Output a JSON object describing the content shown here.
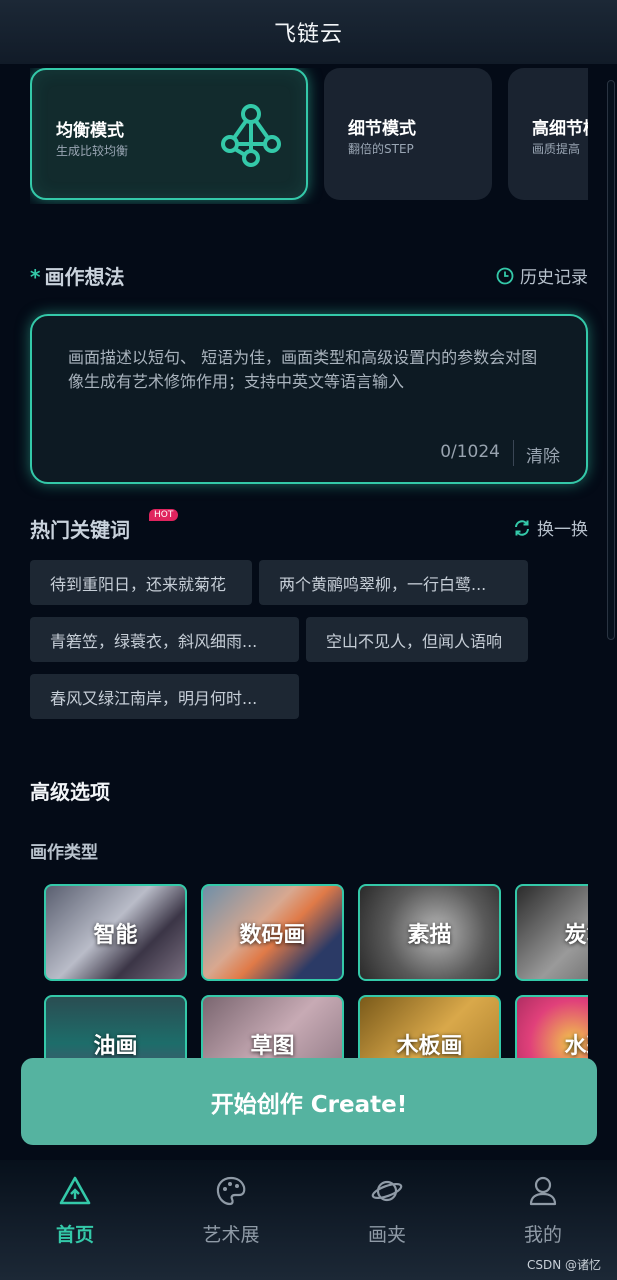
{
  "app": {
    "title": "飞链云"
  },
  "modes": [
    {
      "name": "均衡模式",
      "desc": "生成比较均衡",
      "active": true,
      "icon": "graph-nodes-icon"
    },
    {
      "name": "细节模式",
      "desc": "翻倍的STEP",
      "active": false
    },
    {
      "name": "高细节模",
      "desc": "画质提高",
      "active": false
    }
  ],
  "prompt": {
    "required_mark": "*",
    "title": "画作想法",
    "history_label": "历史记录",
    "placeholder": "画面描述以短句、 短语为佳，画面类型和高级设置内的参数会对图像生成有艺术修饰作用；支持中英文等语言输入",
    "value": "",
    "counter": "0/1024",
    "clear_label": "清除"
  },
  "keywords": {
    "title": "热门关键词",
    "badge": "HOT",
    "refresh_label": "换一换",
    "items": [
      "待到重阳日，还来就菊花",
      "两个黄鹂鸣翠柳，一行白鹭...",
      "青箬笠，绿蓑衣，斜风细雨...",
      "空山不见人，但闻人语响",
      "春风又绿江南岸，明月何时..."
    ]
  },
  "advanced": {
    "title": "高级选项",
    "art_type_title": "画作类型",
    "art_types": [
      "智能",
      "数码画",
      "素描",
      "炭笔",
      "油画",
      "草图",
      "木板画",
      "水彩"
    ]
  },
  "create_button": "开始创作 Create!",
  "tabs": [
    {
      "label": "首页",
      "active": true,
      "icon": "home-icon"
    },
    {
      "label": "艺术展",
      "active": false,
      "icon": "palette-icon"
    },
    {
      "label": "画夹",
      "active": false,
      "icon": "planet-icon"
    },
    {
      "label": "我的",
      "active": false,
      "icon": "user-icon"
    }
  ],
  "watermark": "CSDN @诸忆",
  "colors": {
    "accent": "#34c9a9",
    "create_button": "#55b3a0",
    "background": "#040b17",
    "hot_badge": "#e0245e"
  }
}
